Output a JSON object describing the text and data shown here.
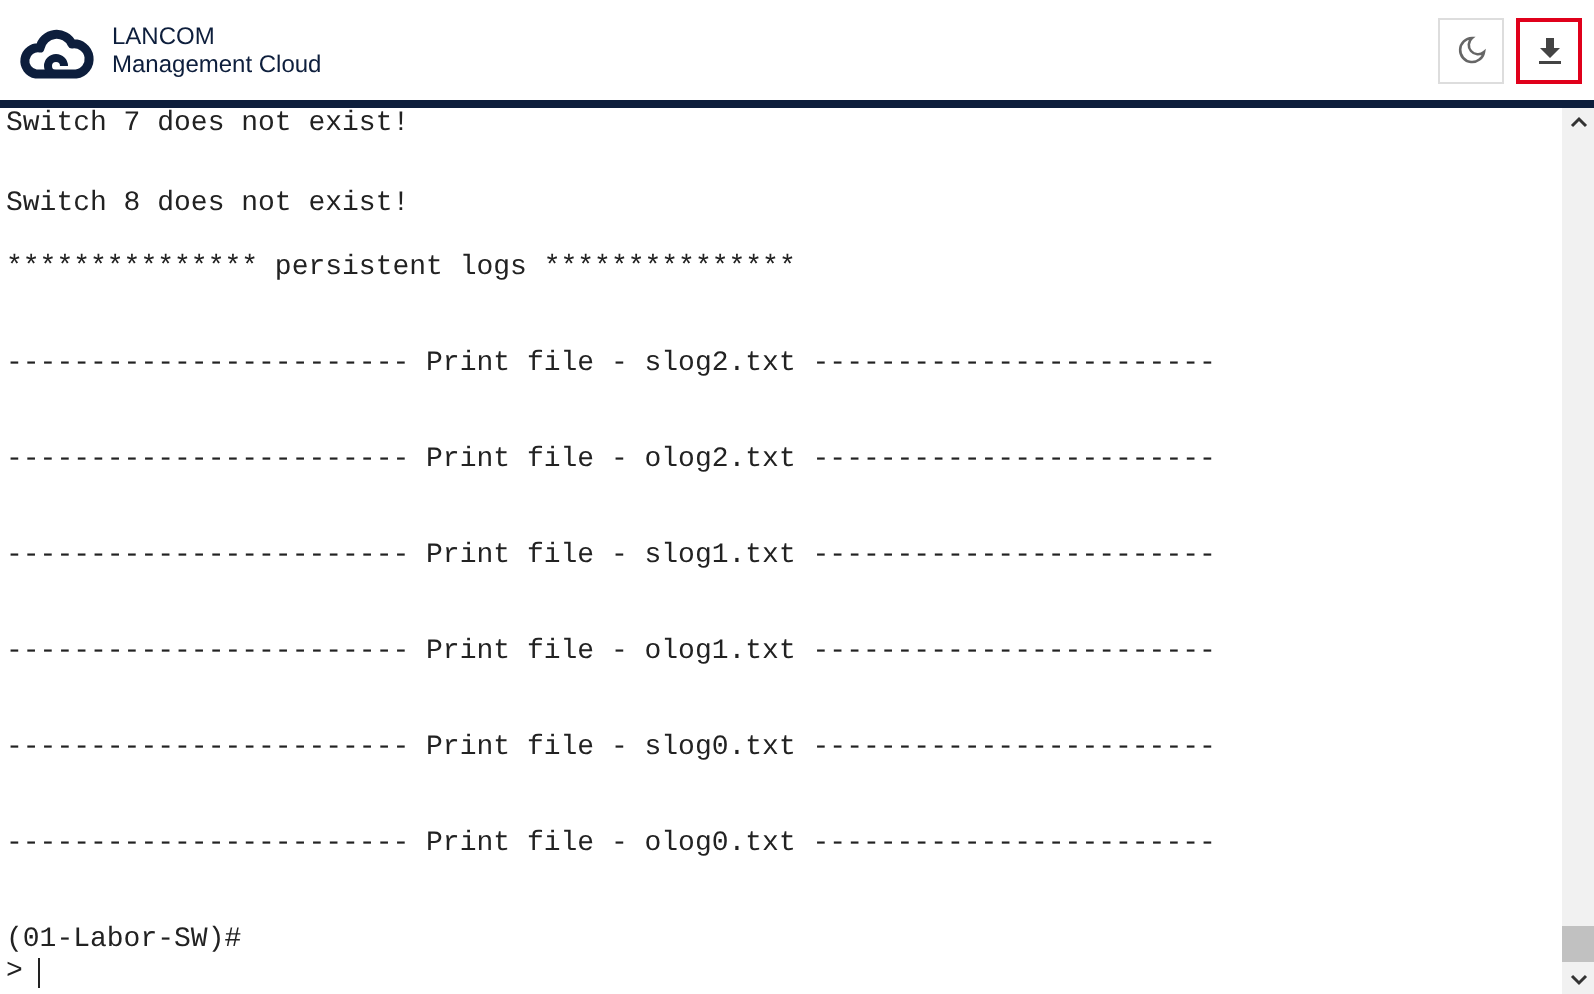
{
  "header": {
    "brand": "LANCOM",
    "product": "Management Cloud",
    "buttons": [
      {
        "kind": "theme",
        "highlighted": false
      },
      {
        "kind": "download",
        "highlighted": true
      }
    ]
  },
  "terminal": {
    "lines": [
      {
        "kind": "output",
        "text": "Switch 7 does not exist!"
      },
      {
        "kind": "output",
        "text": "Switch 8 does not exist!"
      },
      {
        "kind": "banner",
        "text": "*************** persistent logs ***************"
      },
      {
        "kind": "output",
        "text": "------------------------ Print file - slog2.txt ------------------------"
      },
      {
        "kind": "output",
        "text": "------------------------ Print file - olog2.txt ------------------------"
      },
      {
        "kind": "output",
        "text": "------------------------ Print file - slog1.txt ------------------------"
      },
      {
        "kind": "output",
        "text": "------------------------ Print file - olog1.txt ------------------------"
      },
      {
        "kind": "output",
        "text": "------------------------ Print file - slog0.txt ------------------------"
      },
      {
        "kind": "output",
        "text": "------------------------ Print file - olog0.txt ------------------------"
      },
      {
        "kind": "output",
        "text": "(01-Labor-SW)#"
      },
      {
        "kind": "input",
        "text": ">"
      }
    ]
  }
}
